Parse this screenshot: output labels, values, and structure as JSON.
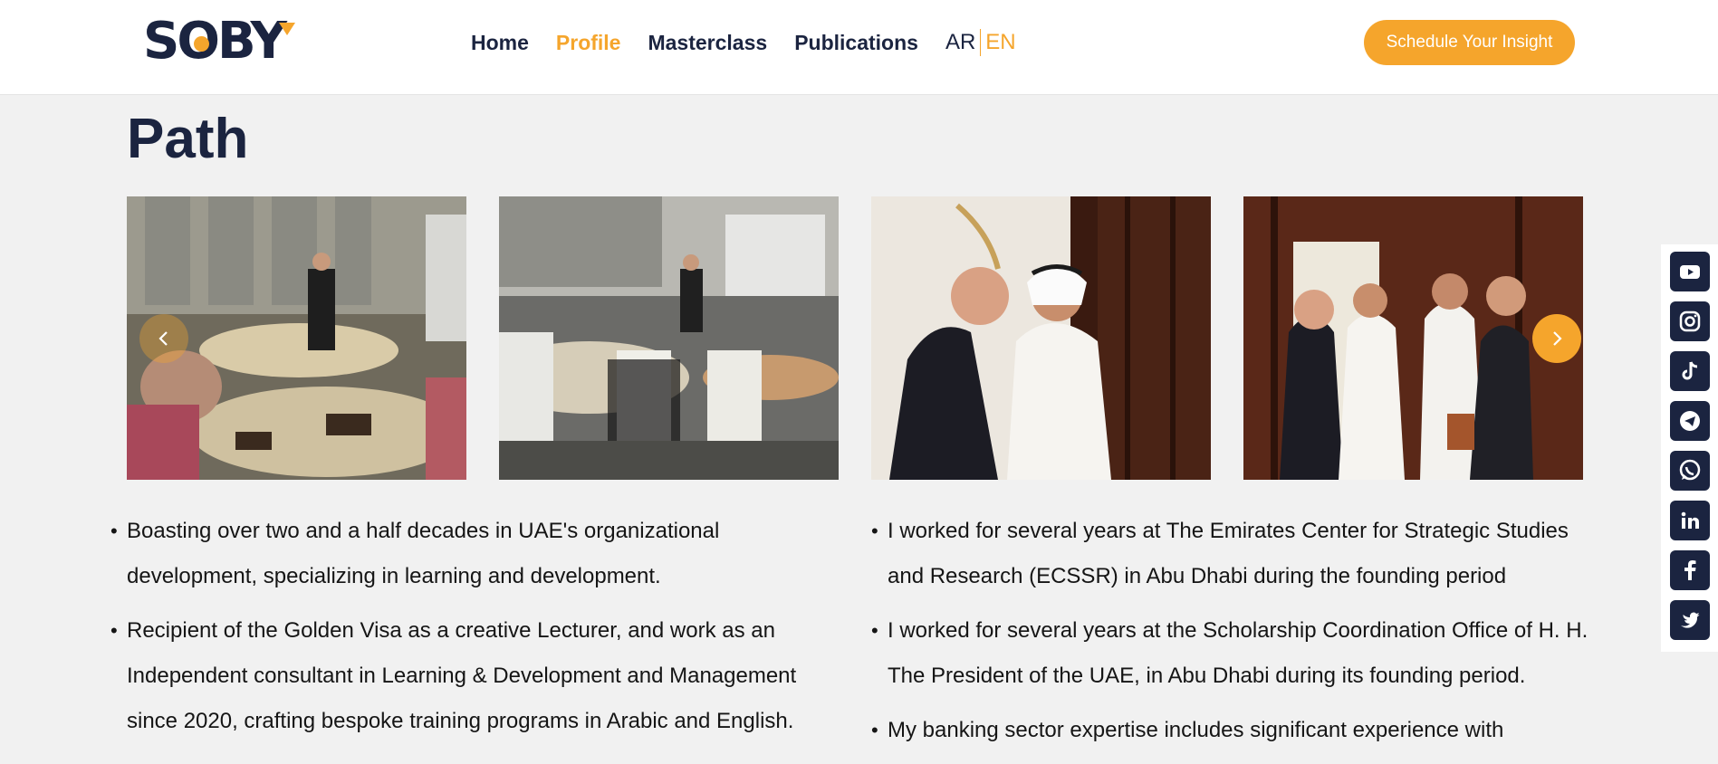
{
  "brand": {
    "logo_text": "SOBY",
    "accent": "#f5a52c",
    "navy": "#1b2440"
  },
  "nav": {
    "items": [
      {
        "label": "Home",
        "active": false
      },
      {
        "label": "Profile",
        "active": true
      },
      {
        "label": "Masterclass",
        "active": false
      },
      {
        "label": "Publications",
        "active": false
      }
    ],
    "lang_ar": "AR",
    "lang_en": "EN"
  },
  "cta": {
    "label": "Schedule Your Insight"
  },
  "section": {
    "title": "Path"
  },
  "gallery": {
    "photos": [
      "training-room-photo",
      "seminar-photo",
      "greeting-photo",
      "group-meeting-photo"
    ],
    "prev_icon": "chevron-left-icon",
    "next_icon": "chevron-right-icon"
  },
  "bullets_left": [
    "Boasting over two and a half decades in UAE's organizational development, specializing in learning and development.",
    "Recipient of the Golden Visa as a creative Lecturer, and work as an Independent consultant in Learning & Development and Management since 2020, crafting bespoke training programs in Arabic and English."
  ],
  "bullets_right": [
    "I worked for several years at The Emirates Center for Strategic Studies and Research (ECSSR) in Abu Dhabi during the founding period",
    "I worked for several years at the Scholarship Coordination Office of H. H. The President of the UAE, in Abu Dhabi during its founding period.",
    "My banking sector expertise includes significant experience with"
  ],
  "social": [
    "youtube-icon",
    "instagram-icon",
    "tiktok-icon",
    "telegram-icon",
    "whatsapp-icon",
    "linkedin-icon",
    "facebook-icon",
    "twitter-icon"
  ]
}
